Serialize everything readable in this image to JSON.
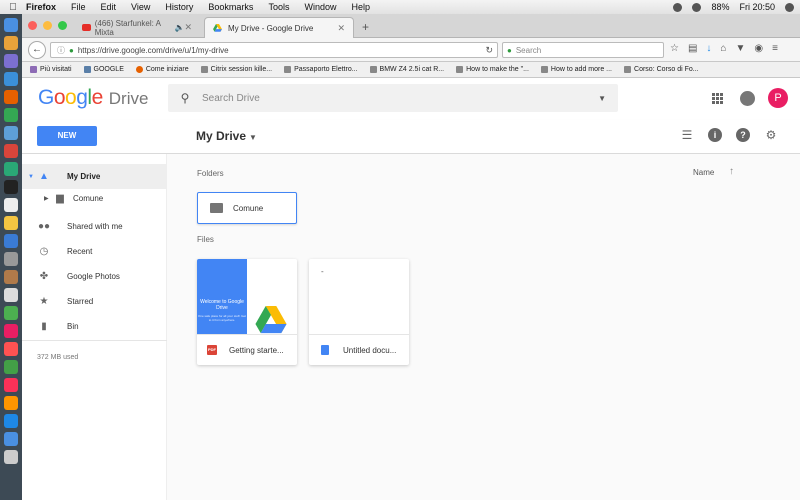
{
  "menubar": {
    "app": "Firefox",
    "items": [
      "File",
      "Edit",
      "View",
      "History",
      "Bookmarks",
      "Tools",
      "Window",
      "Help"
    ],
    "battery": "88%",
    "clock": "Fri 20:50"
  },
  "browser": {
    "tabs": [
      {
        "title": "(466) Starfunkel: A Mixta",
        "active": false
      },
      {
        "title": "My Drive - Google Drive",
        "active": true
      }
    ],
    "new_tab": "+",
    "url": "https://drive.google.com/drive/u/1/my-drive",
    "search_placeholder": "Search",
    "bookmarks": [
      {
        "label": "Più visitati",
        "color": "#8d6bb5"
      },
      {
        "label": "GOOGLE",
        "color": "#5a7fa8"
      },
      {
        "label": "Come iniziare",
        "color": "#e66000"
      },
      {
        "label": "Citrix session kille...",
        "color": "#888888"
      },
      {
        "label": "Passaporto Elettro...",
        "color": "#888888"
      },
      {
        "label": "BMW Z4 2.5i cat R...",
        "color": "#888888"
      },
      {
        "label": "How to make the \"...",
        "color": "#888888"
      },
      {
        "label": "How to add more ...",
        "color": "#888888"
      },
      {
        "label": "Corso: Corso di Fo...",
        "color": "#888888"
      }
    ]
  },
  "drive": {
    "logo": {
      "g1": "G",
      "o1": "o",
      "o2": "o",
      "g2": "g",
      "l": "l",
      "e": "e",
      "product": "Drive"
    },
    "search_placeholder": "Search Drive",
    "avatar_letter": "P",
    "new_button": "NEW",
    "title": "My Drive",
    "sidebar": {
      "my_drive": "My Drive",
      "sub_folder": "Comune",
      "shared": "Shared with me",
      "recent": "Recent",
      "photos": "Google Photos",
      "starred": "Starred",
      "bin": "Bin",
      "storage": "372 MB used"
    },
    "sections": {
      "folders": "Folders",
      "files": "Files"
    },
    "sort_column": "Name",
    "folders": [
      {
        "name": "Comune"
      }
    ],
    "files": [
      {
        "name": "Getting starte...",
        "type": "pdf",
        "thumb_title": "Welcome to Google Drive",
        "thumb_text": "One safe place for all your stuff. Get to it from anywhere."
      },
      {
        "name": "Untitled docu...",
        "type": "doc",
        "thumb_text": "-"
      }
    ],
    "colors": {
      "blue": "#4285f4",
      "red": "#ea4335",
      "yellow": "#fbbc05",
      "green": "#34a853"
    }
  }
}
